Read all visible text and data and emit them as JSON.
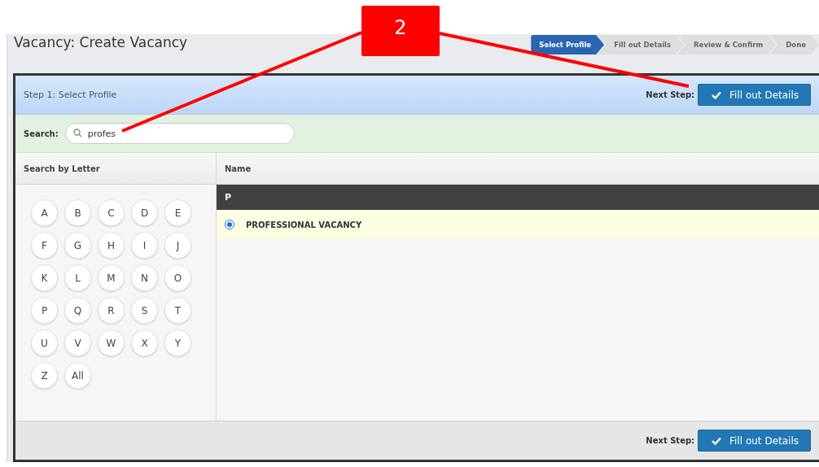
{
  "page": {
    "title": "Vacancy: Create Vacancy"
  },
  "steps": [
    {
      "label": "Select Profile",
      "selected": true
    },
    {
      "label": "Fill out Details",
      "selected": false
    },
    {
      "label": "Review & Confirm",
      "selected": false
    },
    {
      "label": "Done",
      "selected": false
    }
  ],
  "panel": {
    "step_title": "Step 1: Select Profile",
    "next_step_label": "Next Step:",
    "next_button": "Fill out Details"
  },
  "search": {
    "label": "Search:",
    "value": "profes"
  },
  "letters": {
    "heading": "Search by Letter",
    "items": [
      "A",
      "B",
      "C",
      "D",
      "E",
      "F",
      "G",
      "H",
      "I",
      "J",
      "K",
      "L",
      "M",
      "N",
      "O",
      "P",
      "Q",
      "R",
      "S",
      "T",
      "U",
      "V",
      "W",
      "X",
      "Y",
      "Z",
      "All"
    ]
  },
  "results": {
    "column": "Name",
    "groups": [
      {
        "letter": "P",
        "rows": [
          {
            "name": "PROFESSIONAL VACANCY",
            "selected": true
          }
        ]
      }
    ]
  },
  "footer": {
    "next_step_label": "Next Step:",
    "next_button": "Fill out Details"
  },
  "callout": {
    "number": "2"
  }
}
